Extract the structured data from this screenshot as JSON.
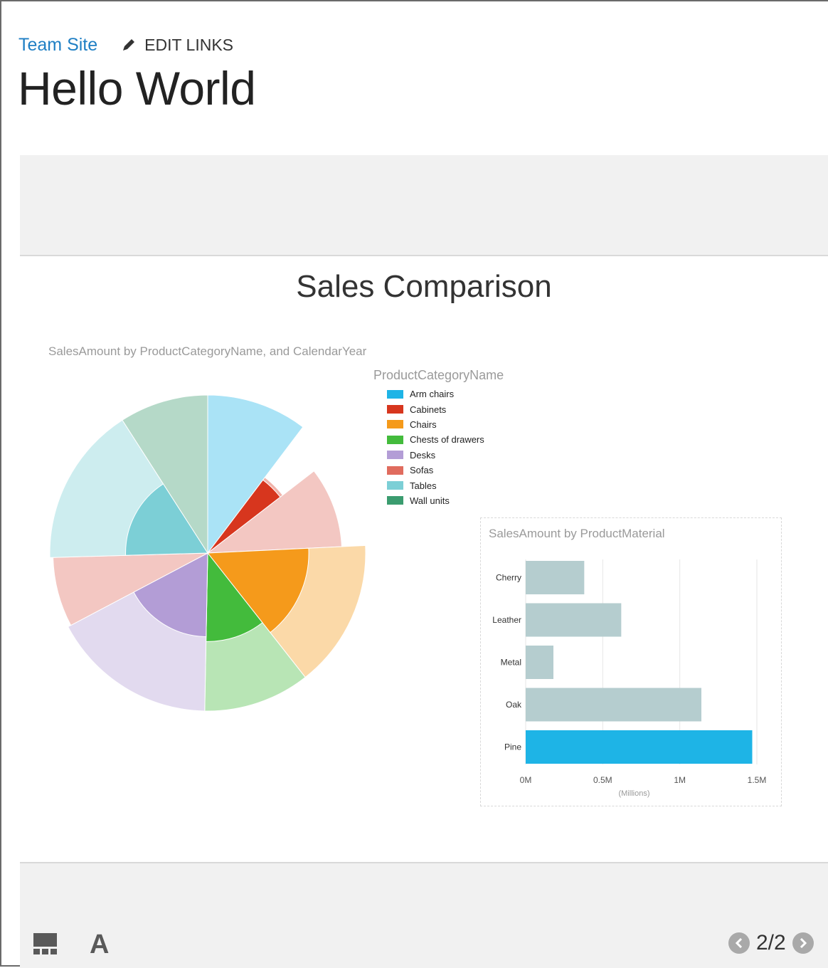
{
  "nav": {
    "site_link": "Team Site",
    "edit_links": "EDIT LINKS"
  },
  "page": {
    "title": "Hello World"
  },
  "slide": {
    "title": "Sales Comparison"
  },
  "colors": {
    "Arm chairs": "#1eb4e6",
    "Cabinets": "#d7361e",
    "Chairs": "#f59a1b",
    "Chests of drawers": "#43bb3c",
    "Desks": "#b39dd6",
    "Sofas": "#e06c5e",
    "Tables": "#7ccfd6",
    "Wall units": "#3b9c6f",
    "bar_muted": "#b5cdcf",
    "bar_selected": "#1eb4e6"
  },
  "chart_data": [
    {
      "type": "polar-pie",
      "title": "SalesAmount by ProductCategoryName, and CalendarYear",
      "legend_title": "ProductCategoryName",
      "legend_position": "right",
      "categories": [
        "Arm chairs",
        "Cabinets",
        "Chairs",
        "Chests of drawers",
        "Desks",
        "Sofas",
        "Tables",
        "Wall units"
      ],
      "note": "",
      "segments": [
        {
          "category": "Arm chairs",
          "angle_share": 0.085,
          "radius_share": 1.0,
          "highlighted_share": 0.0
        },
        {
          "category": "Cabinets",
          "angle_share": 0.035,
          "radius_share": 0.6,
          "highlighted_share": 0.58
        },
        {
          "category": "Sofas",
          "angle_share": 0.08,
          "radius_share": 0.85,
          "highlighted_share": 0.0
        },
        {
          "category": "Chairs",
          "angle_share": 0.125,
          "radius_share": 1.0,
          "highlighted_share": 0.64
        },
        {
          "category": "Chests of drawers",
          "angle_share": 0.09,
          "radius_share": 1.0,
          "highlighted_share": 0.56
        },
        {
          "category": "Desks",
          "angle_share": 0.14,
          "radius_share": 1.0,
          "highlighted_share": 0.53
        },
        {
          "category": "Sofas",
          "angle_share": 0.06,
          "radius_share": 0.98,
          "highlighted_share": 0.0
        },
        {
          "category": "Tables",
          "angle_share": 0.135,
          "radius_share": 1.0,
          "highlighted_share": 0.52
        },
        {
          "category": "Wall units",
          "angle_share": 0.075,
          "radius_share": 1.0,
          "highlighted_share": 0.0
        }
      ]
    },
    {
      "type": "bar",
      "orientation": "horizontal",
      "title": "SalesAmount by ProductMaterial",
      "categories": [
        "Cherry",
        "Leather",
        "Metal",
        "Oak",
        "Pine"
      ],
      "values": [
        0.38,
        0.62,
        0.18,
        1.14,
        1.47
      ],
      "selected": "Pine",
      "x_ticks": [
        "0M",
        "0.5M",
        "1M",
        "1.5M"
      ],
      "x_tick_values": [
        0,
        0.5,
        1,
        1.5
      ],
      "xlabel": "(Millions)",
      "xlim": [
        0,
        1.5
      ],
      "grid": true
    }
  ],
  "footer": {
    "font_icon": "A",
    "page_counter": "2/2"
  },
  "icons": {
    "layout": "layout-grid-icon",
    "font": "font-icon",
    "prev": "prev-arrow-icon",
    "next": "next-arrow-icon",
    "edit": "pencil-icon"
  }
}
